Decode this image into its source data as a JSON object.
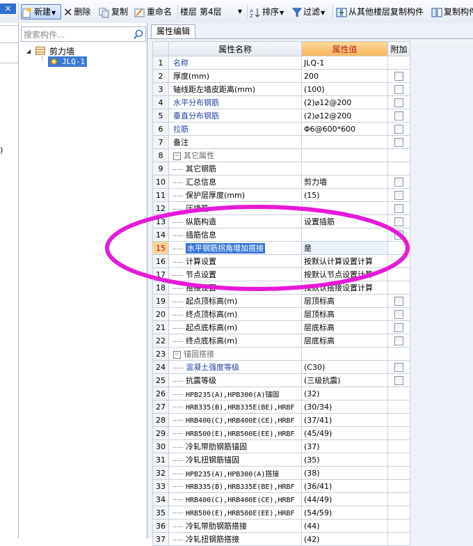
{
  "toolbar": {
    "close_glyph": "×",
    "new_label": "新建",
    "delete_label": "删除",
    "copy_label": "复制",
    "rename_label": "重命名",
    "floor_label": "楼层",
    "floor_value": "第4层",
    "sort_label": "排序",
    "filter_label": "过滤",
    "copy_from_floor_label": "从其他楼层复制构件",
    "copy_to_label": "复制构件"
  },
  "left_strip": {
    "tick_text": ")"
  },
  "left_panel": {
    "search_placeholder": "搜索构件...",
    "tree": {
      "root_label": "剪力墙",
      "child_label": "JLQ-1"
    }
  },
  "prop_panel": {
    "tab_label": "属性编辑",
    "headers": {
      "name": "属性名称",
      "value": "属性值",
      "extra": "附加"
    },
    "rows": [
      {
        "n": "1",
        "name": "名称",
        "value": "JLQ-1",
        "style": "blue",
        "chk": false
      },
      {
        "n": "2",
        "name": "厚度(mm)",
        "value": "200",
        "style": "",
        "chk": true
      },
      {
        "n": "3",
        "name": "轴线距左墙皮距离(mm)",
        "value": "(100)",
        "style": "",
        "chk": true
      },
      {
        "n": "4",
        "name": "水平分布钢筋",
        "value": "(2)⌀12@200",
        "style": "blue",
        "chk": true
      },
      {
        "n": "5",
        "name": "垂直分布钢筋",
        "value": "(2)⌀12@200",
        "style": "blue",
        "chk": true
      },
      {
        "n": "6",
        "name": "拉筋",
        "value": "Φ6@600*600",
        "style": "blue",
        "chk": true
      },
      {
        "n": "7",
        "name": "备注",
        "value": "",
        "style": "",
        "chk": true
      },
      {
        "n": "8",
        "name": "其它属性",
        "value": "",
        "style": "group",
        "chk": false
      },
      {
        "n": "9",
        "name": "其它钢筋",
        "value": "",
        "style": "child",
        "chk": false
      },
      {
        "n": "10",
        "name": "汇总信息",
        "value": "剪力墙",
        "style": "child",
        "chk": true
      },
      {
        "n": "11",
        "name": "保护层厚度(mm)",
        "value": "(15)",
        "style": "child",
        "chk": true
      },
      {
        "n": "12",
        "name": "压墙筋",
        "value": "",
        "style": "child",
        "chk": true
      },
      {
        "n": "13",
        "name": "纵筋构造",
        "value": "设置插筋",
        "style": "child",
        "chk": true
      },
      {
        "n": "14",
        "name": "插筋信息",
        "value": "",
        "style": "child",
        "chk": true
      },
      {
        "n": "15",
        "name": "水平钢筋拐角增加搭接",
        "value": "是",
        "style": "selected",
        "chk": false
      },
      {
        "n": "16",
        "name": "计算设置",
        "value": "按默认计算设置计算",
        "style": "child",
        "chk": false
      },
      {
        "n": "17",
        "name": "节点设置",
        "value": "按默认节点设置计算",
        "style": "child",
        "chk": false
      },
      {
        "n": "18",
        "name": "搭接设置",
        "value": "按默认搭接设置计算",
        "style": "child",
        "chk": false
      },
      {
        "n": "19",
        "name": "起点顶标高(m)",
        "value": "层顶标高",
        "style": "child",
        "chk": true
      },
      {
        "n": "20",
        "name": "终点顶标高(m)",
        "value": "层顶标高",
        "style": "child",
        "chk": true
      },
      {
        "n": "21",
        "name": "起点底标高(m)",
        "value": "层底标高",
        "style": "child",
        "chk": true
      },
      {
        "n": "22",
        "name": "终点底标高(m)",
        "value": "层底标高",
        "style": "child",
        "chk": true
      },
      {
        "n": "23",
        "name": "锚固搭接",
        "value": "",
        "style": "group",
        "chk": false
      },
      {
        "n": "24",
        "name": "混凝土强度等级",
        "value": "(C30)",
        "style": "childblue",
        "chk": true
      },
      {
        "n": "25",
        "name": "抗震等级",
        "value": "(三级抗震)",
        "style": "child",
        "chk": true
      },
      {
        "n": "26",
        "name": "HPB235(A),HPB300(A)锚固",
        "value": "(32)",
        "style": "childmono",
        "chk": false
      },
      {
        "n": "27",
        "name": "HRB335(B),HRB335E(BE),HRBF",
        "value": "(30/34)",
        "style": "childmono",
        "chk": false
      },
      {
        "n": "28",
        "name": "HRB400(C),HRB400E(CE),HRBF",
        "value": "(37/41)",
        "style": "childmono",
        "chk": false
      },
      {
        "n": "29",
        "name": "HRB500(E),HRB500E(EE),HRBF",
        "value": "(45/49)",
        "style": "childmono",
        "chk": false
      },
      {
        "n": "30",
        "name": "冷轧带肋钢筋锚固",
        "value": "(37)",
        "style": "child",
        "chk": false
      },
      {
        "n": "31",
        "name": "冷轧扭钢筋锚固",
        "value": "(35)",
        "style": "child",
        "chk": false
      },
      {
        "n": "32",
        "name": "HPB235(A),HPB300(A)搭接",
        "value": "(38)",
        "style": "childmono",
        "chk": false
      },
      {
        "n": "33",
        "name": "HRB335(B),HRB335E(BE),HRBF",
        "value": "(36/41)",
        "style": "childmono",
        "chk": false
      },
      {
        "n": "34",
        "name": "HRB400(C),HRB400E(CE),HRBF",
        "value": "(44/49)",
        "style": "childmono",
        "chk": false
      },
      {
        "n": "35",
        "name": "HRB500(E),HRB500E(EE),HRBF",
        "value": "(54/59)",
        "style": "childmono",
        "chk": false
      },
      {
        "n": "36",
        "name": "冷轧带肋钢筋搭接",
        "value": "(44)",
        "style": "child",
        "chk": false
      },
      {
        "n": "37",
        "name": "冷轧扭钢筋搭接",
        "value": "(42)",
        "style": "child",
        "chk": false
      }
    ]
  },
  "annotation": {
    "color": "#e619d8"
  },
  "colors": {
    "selection": "#3a78d6",
    "header_value": "#f5b75a",
    "blue_text": "#1f3fa3"
  }
}
